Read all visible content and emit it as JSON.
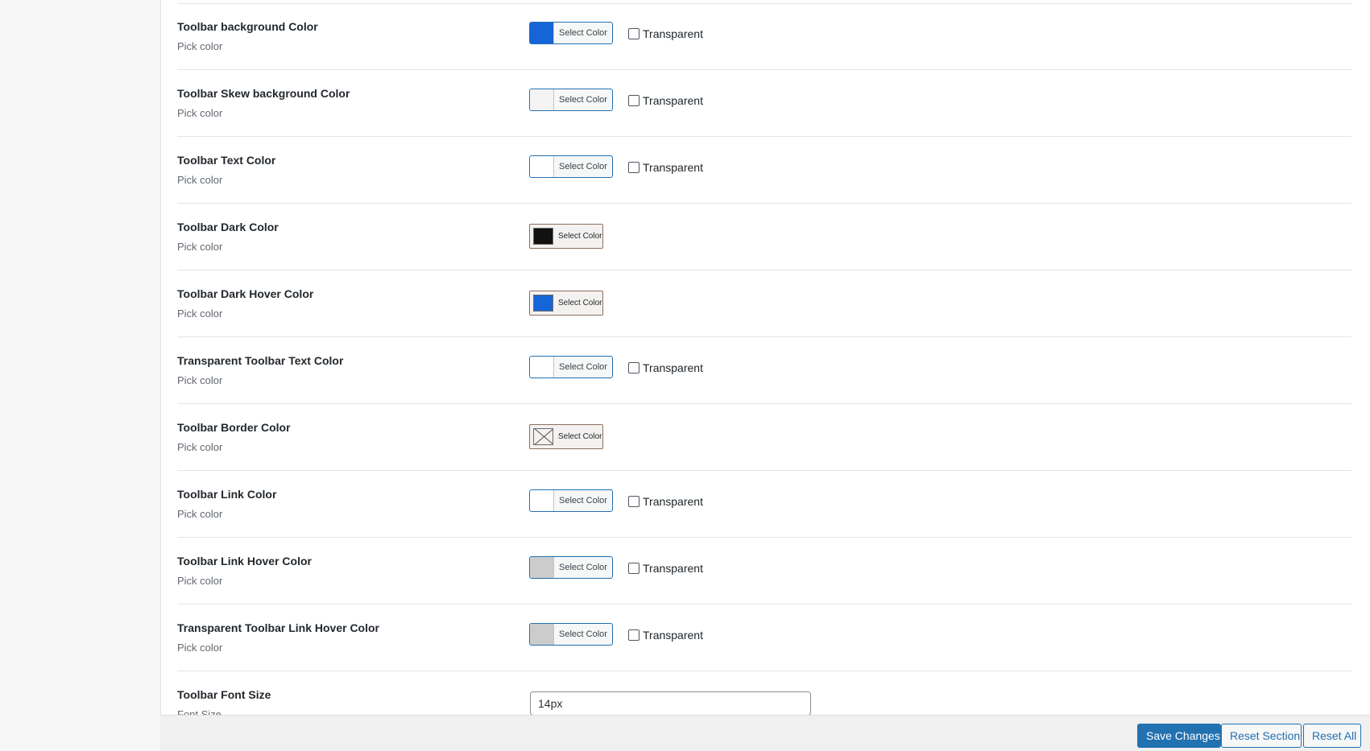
{
  "settings": {
    "rows": [
      {
        "label": "Toolbar background Color",
        "sub": "Pick color",
        "picker_label": "Select Color",
        "swatch": "#1565d8",
        "transparent_label": "Transparent"
      },
      {
        "label": "Toolbar Skew background Color",
        "sub": "Pick color",
        "picker_label": "Select Color",
        "swatch": "#f3f3f3",
        "transparent_label": "Transparent"
      },
      {
        "label": "Toolbar Text Color",
        "sub": "Pick color",
        "picker_label": "Select Color",
        "swatch": "#ffffff",
        "transparent_label": "Transparent"
      },
      {
        "label": "Toolbar Dark Color",
        "sub": "Pick color",
        "picker_label": "Select Color",
        "swatch": "#111111"
      },
      {
        "label": "Toolbar Dark Hover Color",
        "sub": "Pick color",
        "picker_label": "Select Color",
        "swatch": "#1565d8"
      },
      {
        "label": "Transparent Toolbar Text Color",
        "sub": "Pick color",
        "picker_label": "Select Color",
        "swatch": "#ffffff",
        "transparent_label": "Transparent"
      },
      {
        "label": "Toolbar Border Color",
        "sub": "Pick color",
        "picker_label": "Select Color",
        "swatch": "none"
      },
      {
        "label": "Toolbar Link Color",
        "sub": "Pick color",
        "picker_label": "Select Color",
        "swatch": "#ffffff",
        "transparent_label": "Transparent"
      },
      {
        "label": "Toolbar Link Hover Color",
        "sub": "Pick color",
        "picker_label": "Select Color",
        "swatch": "#cccccc",
        "transparent_label": "Transparent"
      },
      {
        "label": "Transparent Toolbar Link Hover Color",
        "sub": "Pick color",
        "picker_label": "Select Color",
        "swatch": "#cccccc",
        "transparent_label": "Transparent"
      },
      {
        "label": "Toolbar Font Size",
        "sub": "Font Size",
        "input_value": "14px"
      }
    ]
  },
  "footer": {
    "save_label": "Save Changes",
    "reset_section_label": "Reset Section",
    "reset_all_label": "Reset All"
  },
  "colors": {
    "accent": "#2271b1"
  }
}
